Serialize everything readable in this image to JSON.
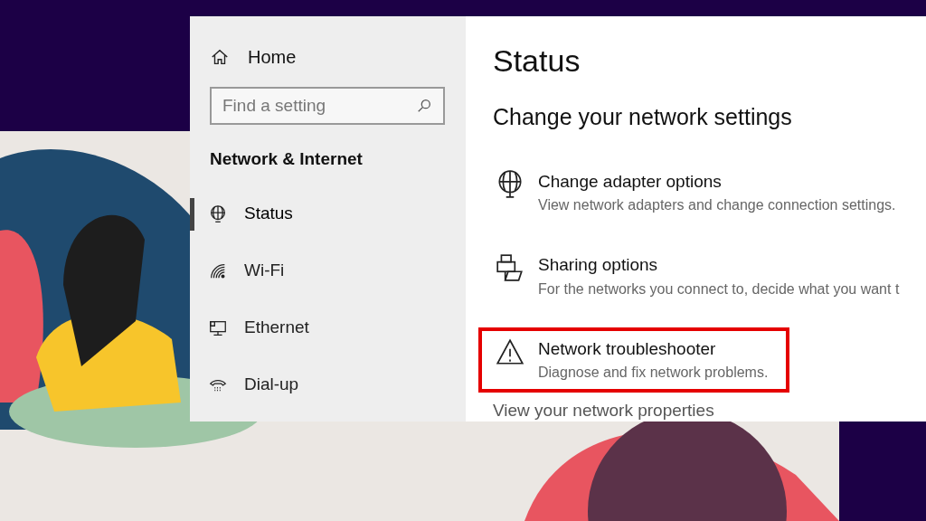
{
  "sidebar": {
    "home": "Home",
    "search": {
      "placeholder": "Find a setting"
    },
    "section_title": "Network & Internet",
    "items": [
      {
        "label": "Status",
        "kind": "status",
        "selected": true
      },
      {
        "label": "Wi-Fi",
        "kind": "wifi",
        "selected": false
      },
      {
        "label": "Ethernet",
        "kind": "ethernet",
        "selected": false
      },
      {
        "label": "Dial-up",
        "kind": "dialup",
        "selected": false
      }
    ]
  },
  "content": {
    "title": "Status",
    "subtitle": "Change your network settings",
    "options": [
      {
        "kind": "adapter",
        "title": "Change adapter options",
        "description": "View network adapters and change connection settings.",
        "highlighted": false
      },
      {
        "kind": "sharing",
        "title": "Sharing options",
        "description": "For the networks you connect to, decide what you want t",
        "highlighted": false
      },
      {
        "kind": "troubleshooter",
        "title": "Network troubleshooter",
        "description": "Diagnose and fix network problems.",
        "highlighted": true
      }
    ],
    "link": "View your network properties"
  }
}
